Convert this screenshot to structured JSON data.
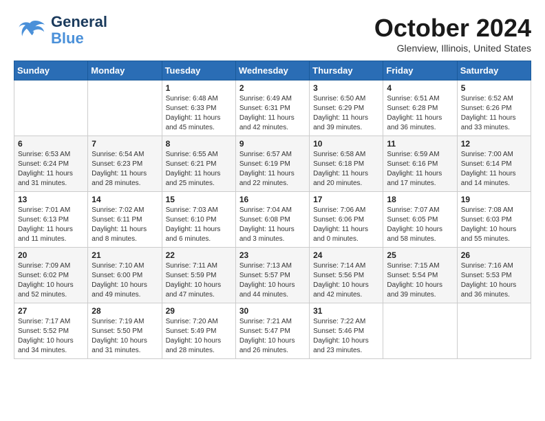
{
  "header": {
    "logo_line1": "General",
    "logo_line2": "Blue",
    "month": "October 2024",
    "location": "Glenview, Illinois, United States"
  },
  "weekdays": [
    "Sunday",
    "Monday",
    "Tuesday",
    "Wednesday",
    "Thursday",
    "Friday",
    "Saturday"
  ],
  "weeks": [
    [
      {
        "day": "",
        "sunrise": "",
        "sunset": "",
        "daylight": ""
      },
      {
        "day": "",
        "sunrise": "",
        "sunset": "",
        "daylight": ""
      },
      {
        "day": "1",
        "sunrise": "Sunrise: 6:48 AM",
        "sunset": "Sunset: 6:33 PM",
        "daylight": "Daylight: 11 hours and 45 minutes."
      },
      {
        "day": "2",
        "sunrise": "Sunrise: 6:49 AM",
        "sunset": "Sunset: 6:31 PM",
        "daylight": "Daylight: 11 hours and 42 minutes."
      },
      {
        "day": "3",
        "sunrise": "Sunrise: 6:50 AM",
        "sunset": "Sunset: 6:29 PM",
        "daylight": "Daylight: 11 hours and 39 minutes."
      },
      {
        "day": "4",
        "sunrise": "Sunrise: 6:51 AM",
        "sunset": "Sunset: 6:28 PM",
        "daylight": "Daylight: 11 hours and 36 minutes."
      },
      {
        "day": "5",
        "sunrise": "Sunrise: 6:52 AM",
        "sunset": "Sunset: 6:26 PM",
        "daylight": "Daylight: 11 hours and 33 minutes."
      }
    ],
    [
      {
        "day": "6",
        "sunrise": "Sunrise: 6:53 AM",
        "sunset": "Sunset: 6:24 PM",
        "daylight": "Daylight: 11 hours and 31 minutes."
      },
      {
        "day": "7",
        "sunrise": "Sunrise: 6:54 AM",
        "sunset": "Sunset: 6:23 PM",
        "daylight": "Daylight: 11 hours and 28 minutes."
      },
      {
        "day": "8",
        "sunrise": "Sunrise: 6:55 AM",
        "sunset": "Sunset: 6:21 PM",
        "daylight": "Daylight: 11 hours and 25 minutes."
      },
      {
        "day": "9",
        "sunrise": "Sunrise: 6:57 AM",
        "sunset": "Sunset: 6:19 PM",
        "daylight": "Daylight: 11 hours and 22 minutes."
      },
      {
        "day": "10",
        "sunrise": "Sunrise: 6:58 AM",
        "sunset": "Sunset: 6:18 PM",
        "daylight": "Daylight: 11 hours and 20 minutes."
      },
      {
        "day": "11",
        "sunrise": "Sunrise: 6:59 AM",
        "sunset": "Sunset: 6:16 PM",
        "daylight": "Daylight: 11 hours and 17 minutes."
      },
      {
        "day": "12",
        "sunrise": "Sunrise: 7:00 AM",
        "sunset": "Sunset: 6:14 PM",
        "daylight": "Daylight: 11 hours and 14 minutes."
      }
    ],
    [
      {
        "day": "13",
        "sunrise": "Sunrise: 7:01 AM",
        "sunset": "Sunset: 6:13 PM",
        "daylight": "Daylight: 11 hours and 11 minutes."
      },
      {
        "day": "14",
        "sunrise": "Sunrise: 7:02 AM",
        "sunset": "Sunset: 6:11 PM",
        "daylight": "Daylight: 11 hours and 8 minutes."
      },
      {
        "day": "15",
        "sunrise": "Sunrise: 7:03 AM",
        "sunset": "Sunset: 6:10 PM",
        "daylight": "Daylight: 11 hours and 6 minutes."
      },
      {
        "day": "16",
        "sunrise": "Sunrise: 7:04 AM",
        "sunset": "Sunset: 6:08 PM",
        "daylight": "Daylight: 11 hours and 3 minutes."
      },
      {
        "day": "17",
        "sunrise": "Sunrise: 7:06 AM",
        "sunset": "Sunset: 6:06 PM",
        "daylight": "Daylight: 11 hours and 0 minutes."
      },
      {
        "day": "18",
        "sunrise": "Sunrise: 7:07 AM",
        "sunset": "Sunset: 6:05 PM",
        "daylight": "Daylight: 10 hours and 58 minutes."
      },
      {
        "day": "19",
        "sunrise": "Sunrise: 7:08 AM",
        "sunset": "Sunset: 6:03 PM",
        "daylight": "Daylight: 10 hours and 55 minutes."
      }
    ],
    [
      {
        "day": "20",
        "sunrise": "Sunrise: 7:09 AM",
        "sunset": "Sunset: 6:02 PM",
        "daylight": "Daylight: 10 hours and 52 minutes."
      },
      {
        "day": "21",
        "sunrise": "Sunrise: 7:10 AM",
        "sunset": "Sunset: 6:00 PM",
        "daylight": "Daylight: 10 hours and 49 minutes."
      },
      {
        "day": "22",
        "sunrise": "Sunrise: 7:11 AM",
        "sunset": "Sunset: 5:59 PM",
        "daylight": "Daylight: 10 hours and 47 minutes."
      },
      {
        "day": "23",
        "sunrise": "Sunrise: 7:13 AM",
        "sunset": "Sunset: 5:57 PM",
        "daylight": "Daylight: 10 hours and 44 minutes."
      },
      {
        "day": "24",
        "sunrise": "Sunrise: 7:14 AM",
        "sunset": "Sunset: 5:56 PM",
        "daylight": "Daylight: 10 hours and 42 minutes."
      },
      {
        "day": "25",
        "sunrise": "Sunrise: 7:15 AM",
        "sunset": "Sunset: 5:54 PM",
        "daylight": "Daylight: 10 hours and 39 minutes."
      },
      {
        "day": "26",
        "sunrise": "Sunrise: 7:16 AM",
        "sunset": "Sunset: 5:53 PM",
        "daylight": "Daylight: 10 hours and 36 minutes."
      }
    ],
    [
      {
        "day": "27",
        "sunrise": "Sunrise: 7:17 AM",
        "sunset": "Sunset: 5:52 PM",
        "daylight": "Daylight: 10 hours and 34 minutes."
      },
      {
        "day": "28",
        "sunrise": "Sunrise: 7:19 AM",
        "sunset": "Sunset: 5:50 PM",
        "daylight": "Daylight: 10 hours and 31 minutes."
      },
      {
        "day": "29",
        "sunrise": "Sunrise: 7:20 AM",
        "sunset": "Sunset: 5:49 PM",
        "daylight": "Daylight: 10 hours and 28 minutes."
      },
      {
        "day": "30",
        "sunrise": "Sunrise: 7:21 AM",
        "sunset": "Sunset: 5:47 PM",
        "daylight": "Daylight: 10 hours and 26 minutes."
      },
      {
        "day": "31",
        "sunrise": "Sunrise: 7:22 AM",
        "sunset": "Sunset: 5:46 PM",
        "daylight": "Daylight: 10 hours and 23 minutes."
      },
      {
        "day": "",
        "sunrise": "",
        "sunset": "",
        "daylight": ""
      },
      {
        "day": "",
        "sunrise": "",
        "sunset": "",
        "daylight": ""
      }
    ]
  ]
}
